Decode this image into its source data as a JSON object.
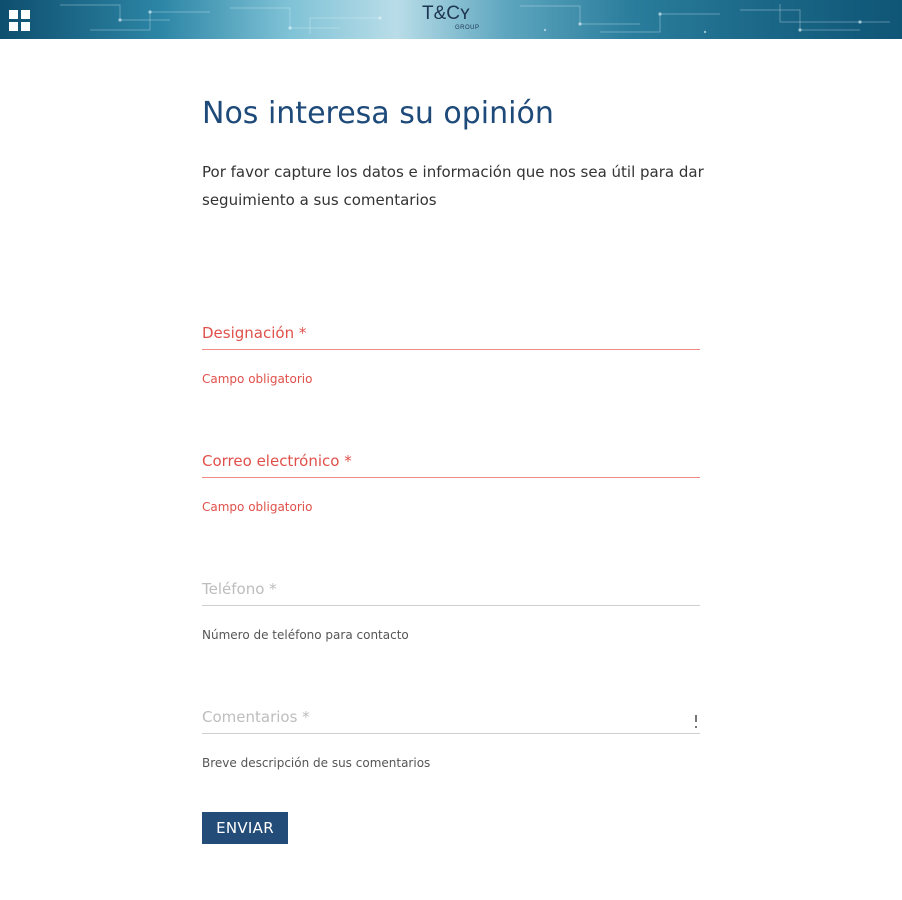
{
  "header": {
    "brand_main": "T&Cʏ",
    "brand_sub": "GROUP",
    "menu_icon": "apps-grid-icon"
  },
  "form": {
    "title": "Nos interesa su opinión",
    "intro": "Por favor capture los datos e información que nos sea útil para dar seguimiento a sus comentarios",
    "fields": [
      {
        "label": "Designación *",
        "value": "",
        "help": "Campo obligatorio",
        "state": "error"
      },
      {
        "label": "Correo electrónico *",
        "value": "",
        "help": "Campo obligatorio",
        "state": "error"
      },
      {
        "label": "Teléfono *",
        "value": "",
        "help": "Número de teléfono para contacto",
        "state": "normal"
      },
      {
        "label": "Comentarios *",
        "value": "",
        "help": "Breve descripción de sus comentarios",
        "state": "normal"
      }
    ],
    "submit_label": "ENVIAR"
  },
  "colors": {
    "title": "#1e4a79",
    "error": "#e0504a",
    "button": "#234c78",
    "banner_dark": "#0e4e6e",
    "banner_light": "#b9dde8"
  }
}
